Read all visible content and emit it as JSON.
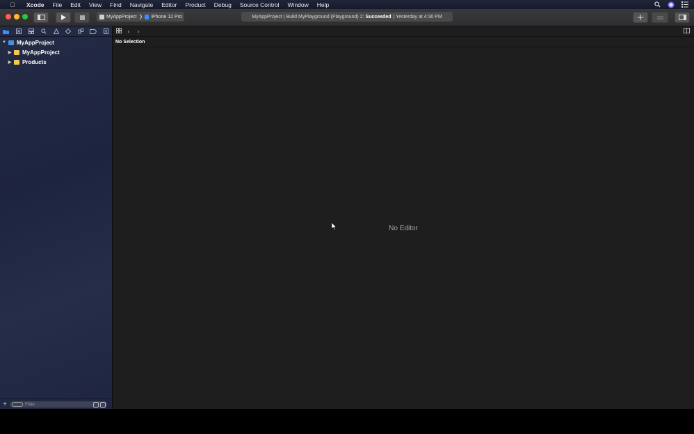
{
  "menubar": {
    "app": "Xcode",
    "items": [
      "File",
      "Edit",
      "View",
      "Find",
      "Navigate",
      "Editor",
      "Product",
      "Debug",
      "Source Control",
      "Window",
      "Help"
    ]
  },
  "toolbar": {
    "scheme_project": "MyAppProject",
    "scheme_device": "iPhone 12 Pro",
    "activity_prefix": "MyAppProject | Build MyPlayground (Playground) 2:",
    "activity_status": "Succeeded",
    "activity_time": "| Yesterday at 4:30 PM"
  },
  "navigator": {
    "items": [
      {
        "label": "MyAppProject",
        "level": 0,
        "kind": "project"
      },
      {
        "label": "MyAppProject",
        "level": 1,
        "kind": "folder"
      },
      {
        "label": "Products",
        "level": 1,
        "kind": "folder"
      }
    ],
    "filter_placeholder": "Filter"
  },
  "editor": {
    "breadcrumb": "No Selection",
    "empty_message": "No Editor"
  },
  "colors": {
    "accent": "#3d8cff",
    "close": "#ff5f57",
    "minimize": "#febc2e",
    "zoom": "#28c840"
  }
}
